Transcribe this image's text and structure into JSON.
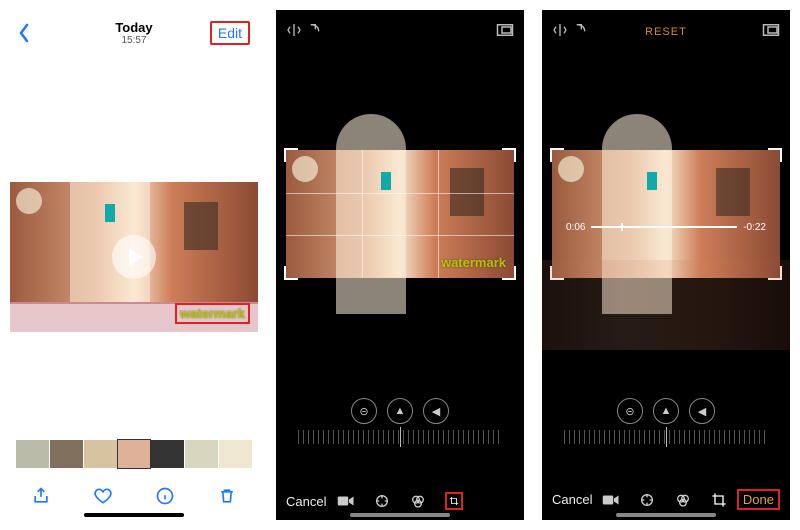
{
  "panelA": {
    "title": "Today",
    "subtitle": "15:57",
    "edit": "Edit",
    "watermark": "watermark"
  },
  "panelB": {
    "watermark": "watermark",
    "cancel": "Cancel"
  },
  "panelC": {
    "reset": "RESET",
    "time_elapsed": "0:06",
    "time_remaining": "-0:22",
    "cancel": "Cancel",
    "done": "Done"
  },
  "highlight_color": "#d22",
  "accent_orange": "#e2a53c",
  "ios_blue": "#2078ff"
}
